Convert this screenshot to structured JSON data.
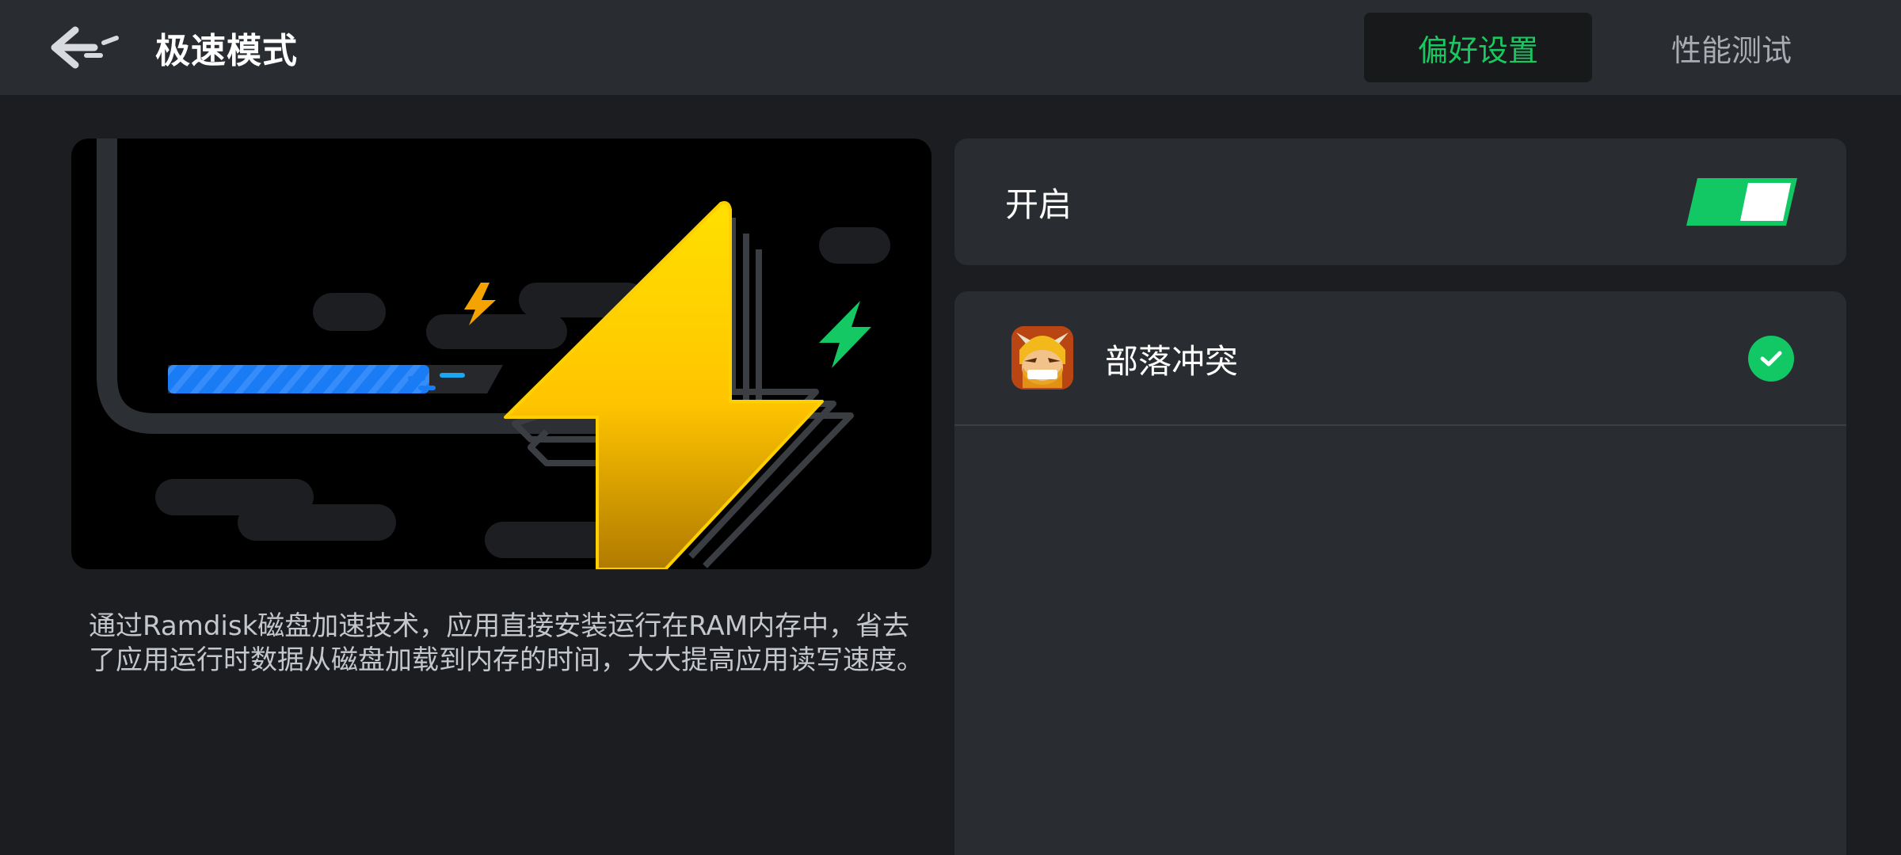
{
  "header": {
    "back_icon": "back-arrow-icon",
    "title": "极速模式",
    "tabs": [
      {
        "label": "偏好设置",
        "active": true
      },
      {
        "label": "性能测试",
        "active": false
      }
    ]
  },
  "description": "通过Ramdisk磁盘加速技术，应用直接安装运行在RAM内存中，省去了应用运行时数据从磁盘加载到内存的时间，大大提高应用读写速度。",
  "toggle": {
    "label": "开启",
    "on": true
  },
  "apps": [
    {
      "name": "部落冲突",
      "icon": "clash-of-clans-app-icon",
      "selected": true
    }
  ],
  "colors": {
    "accent": "#18c960",
    "background": "#1b1d20",
    "panel": "#292c30",
    "lightning": "#ffd000",
    "progress": "#1a7cf5"
  }
}
